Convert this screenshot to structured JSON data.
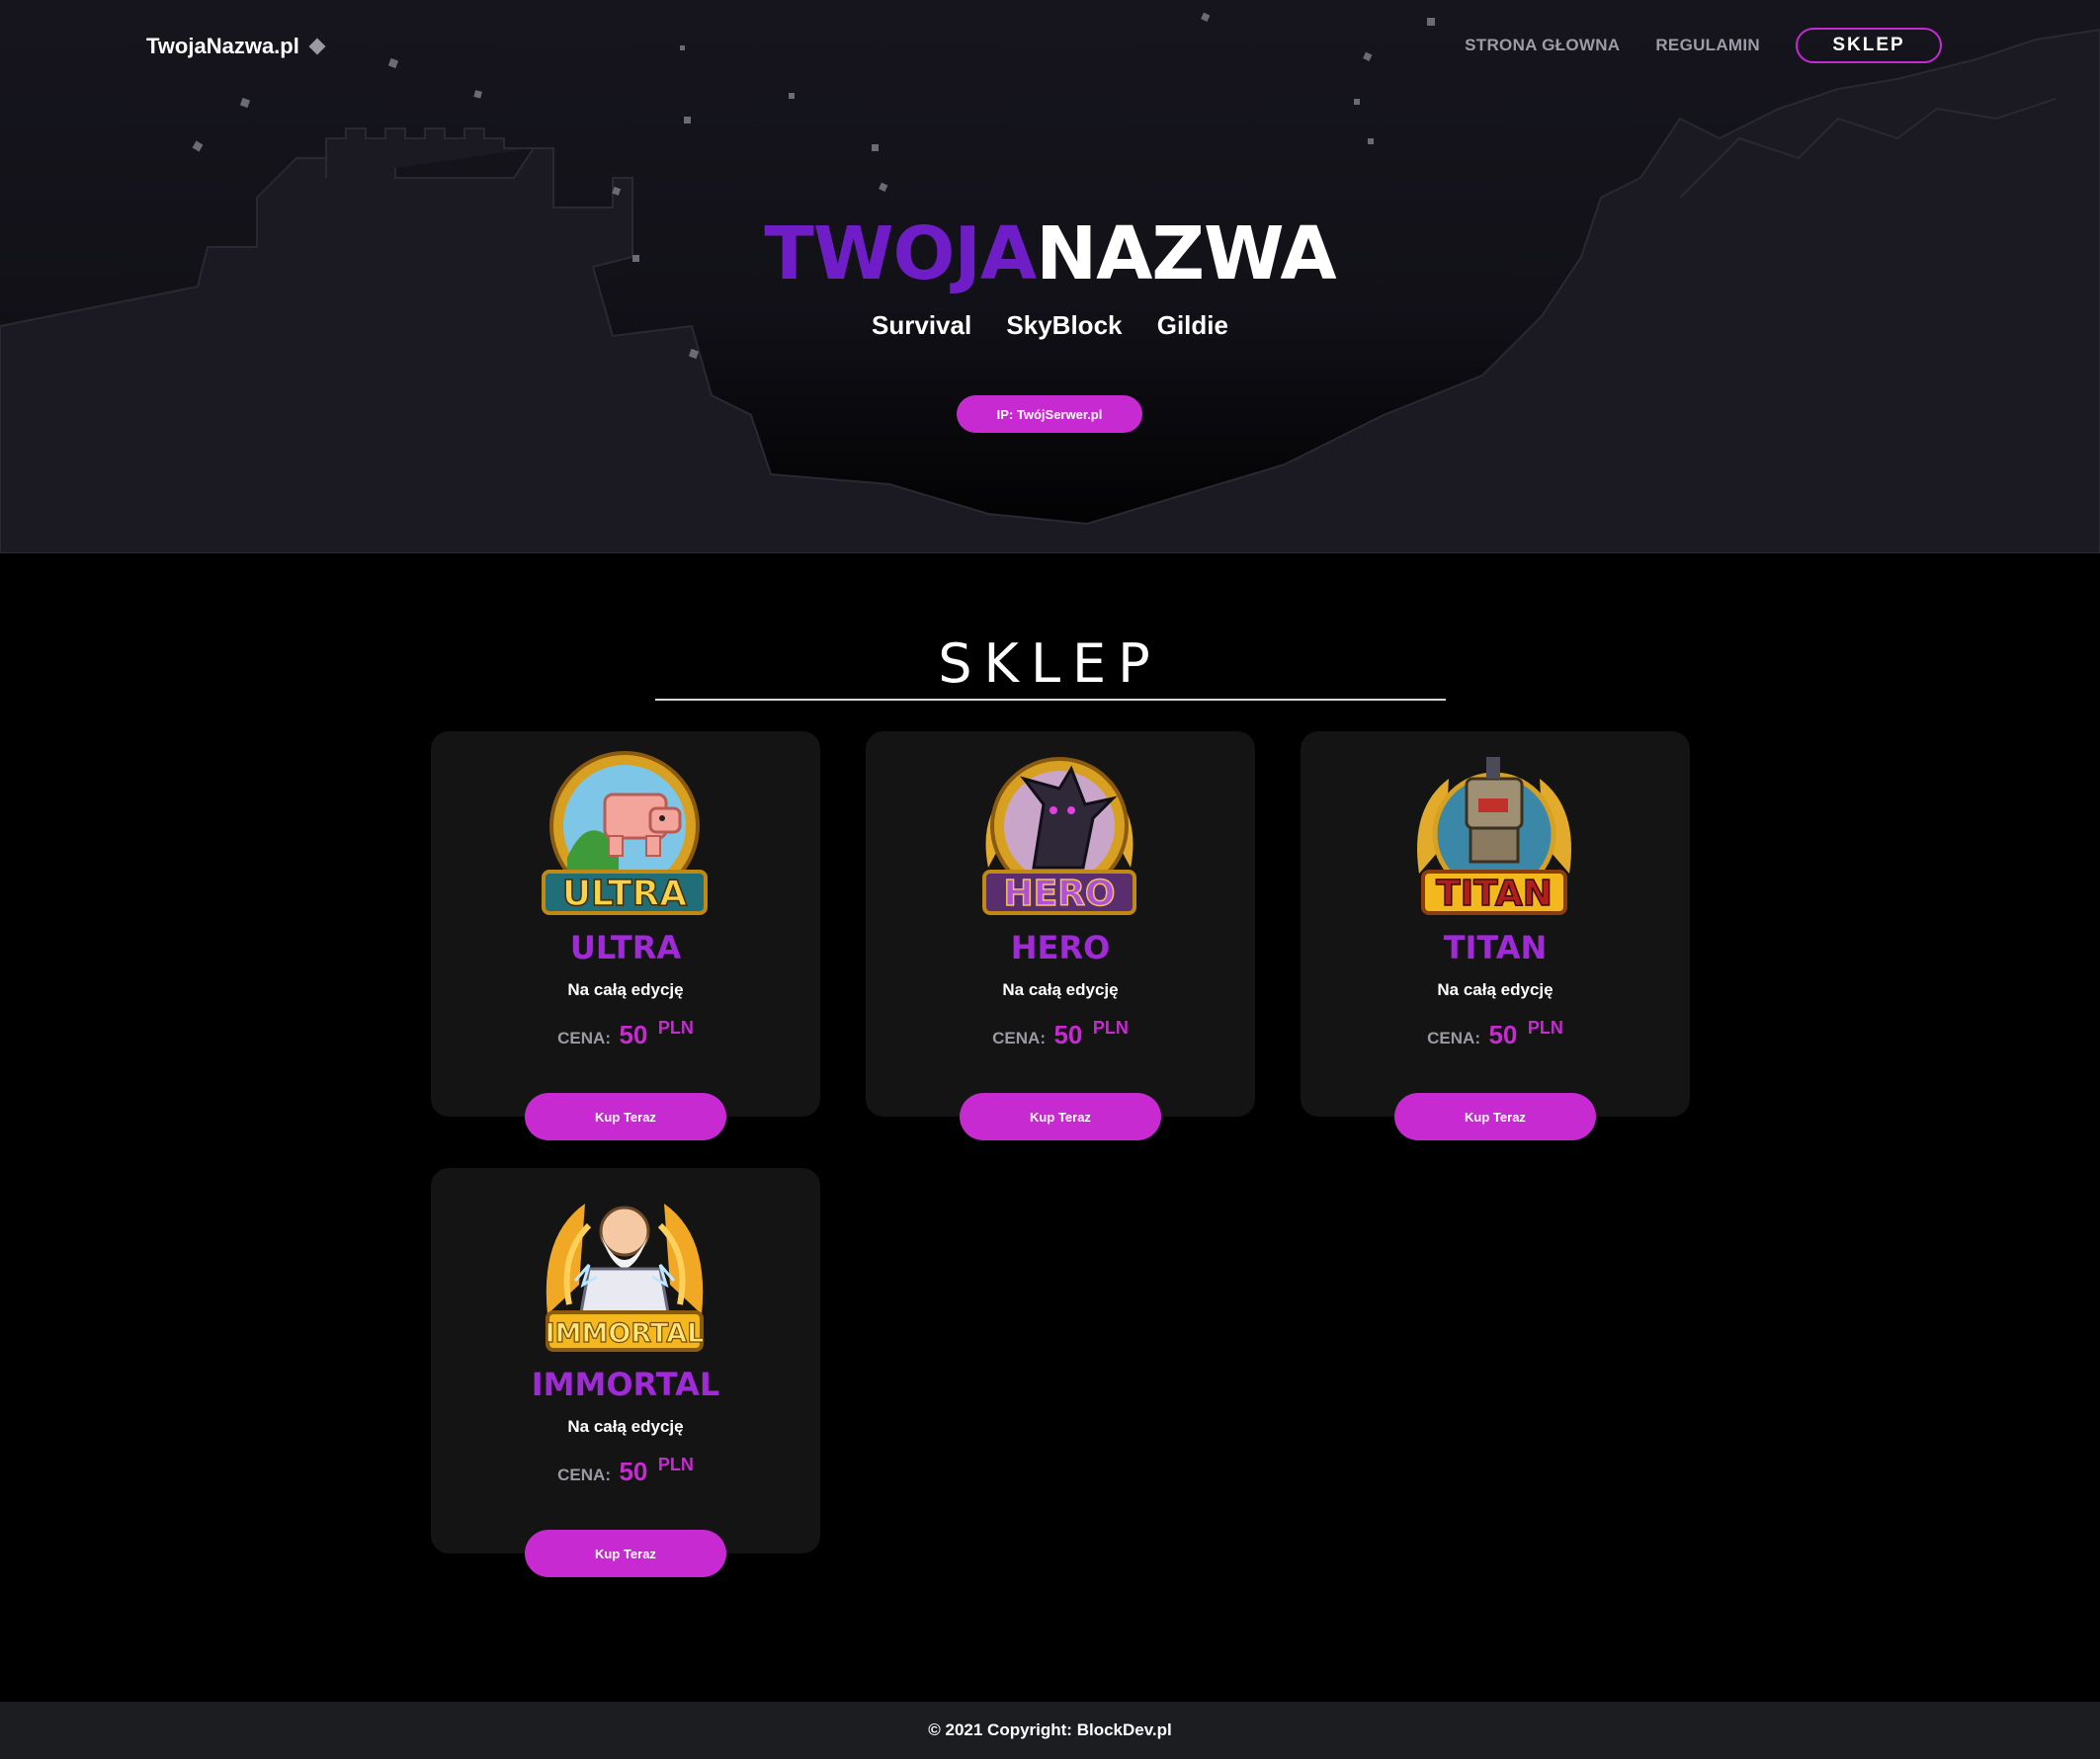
{
  "nav": {
    "logo": "TwojaNazwa.pl",
    "links": [
      "STRONA GŁOWNA",
      "REGULAMIN"
    ],
    "shop_label": "SKLEP"
  },
  "hero": {
    "title_part1": "TWOJA",
    "title_part2": "NAZWA",
    "modes": [
      "Survival",
      "SkyBlock",
      "Gildie"
    ],
    "ip_label": "IP: TwójSerwer.pl"
  },
  "shop": {
    "title": "SKLEP",
    "products": [
      {
        "name": "ULTRA",
        "badge_text": "ULTRA",
        "desc": "Na całą edycję",
        "price_label": "CENA:",
        "price": "50",
        "currency": "PLN",
        "button": "Kup Teraz"
      },
      {
        "name": "HERO",
        "badge_text": "HERO",
        "desc": "Na całą edycję",
        "price_label": "CENA:",
        "price": "50",
        "currency": "PLN",
        "button": "Kup Teraz"
      },
      {
        "name": "TITAN",
        "badge_text": "TITAN",
        "desc": "Na całą edycję",
        "price_label": "CENA:",
        "price": "50",
        "currency": "PLN",
        "button": "Kup Teraz"
      },
      {
        "name": "IMMORTAL",
        "badge_text": "IMMORTAL",
        "desc": "Na całą edycję",
        "price_label": "CENA:",
        "price": "50",
        "currency": "PLN",
        "button": "Kup Teraz"
      }
    ]
  },
  "footer": {
    "text": "© 2021 Copyright: BlockDev.pl"
  },
  "colors": {
    "accent": "#c82ad1",
    "title_purple": "#6f1ec7",
    "product_name": "#a02ad6",
    "card_bg": "#141414",
    "footer_bg": "#1b1d20"
  }
}
